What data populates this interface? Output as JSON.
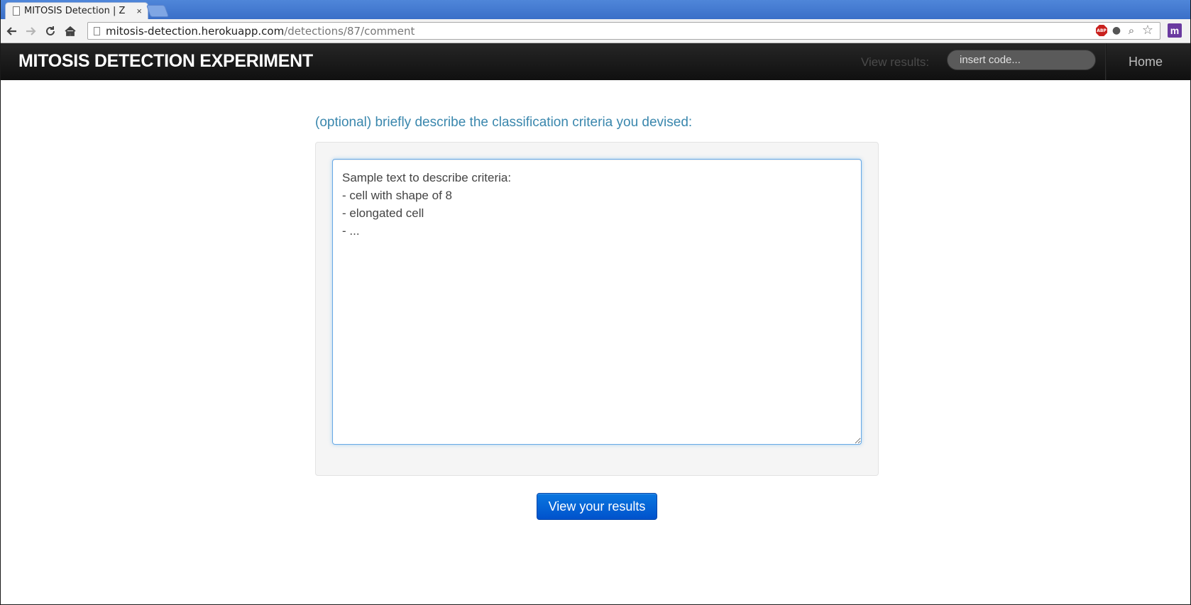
{
  "browser": {
    "tab_title": "MITOSIS Detection | Z",
    "tab_close": "×",
    "url_host": "mitosis-detection.herokuapp.com",
    "url_path": "/detections/87/comment",
    "icons": {
      "back": "arrow-left",
      "forward": "arrow-right",
      "reload": "reload",
      "home": "home",
      "adblock": "abp",
      "bulb": "lightbulb",
      "zoom": "magnifier",
      "bookmark": "star",
      "extension": "m"
    }
  },
  "navbar": {
    "brand": "MITOSIS DETECTION EXPERIMENT",
    "view_results_label": "View results:",
    "code_placeholder": "insert code...",
    "home_label": "Home"
  },
  "main": {
    "prompt": "(optional) briefly describe the classification criteria you devised:",
    "criteria_text": "Sample text to describe criteria:\n- cell with shape of 8\n- elongated cell\n- ...",
    "submit_label": "View your results"
  },
  "colors": {
    "navbar_bg": "#1b1b1b",
    "prompt_text": "#3a87ad",
    "button_bg": "#0062d6",
    "tabstrip_bg": "#4a7fd4"
  }
}
